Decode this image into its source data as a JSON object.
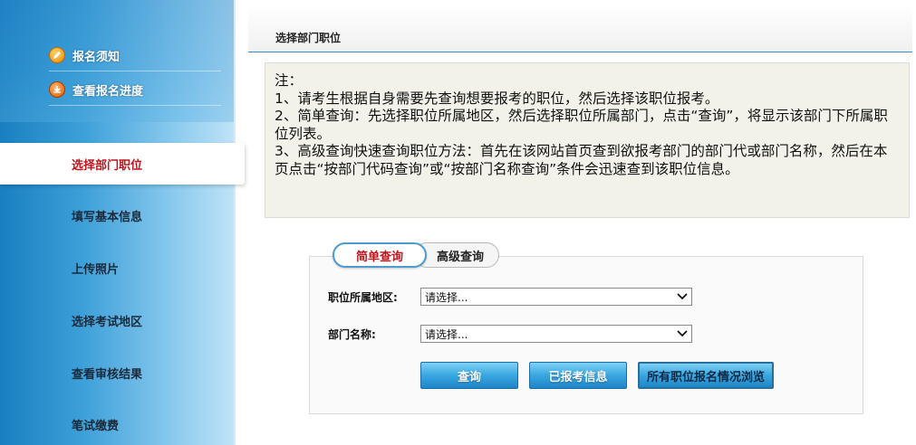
{
  "sidebar": {
    "top_links": [
      {
        "label": "报名须知",
        "icon": "pencil-icon"
      },
      {
        "label": "查看报名进度",
        "icon": "progress-icon"
      }
    ],
    "items": [
      {
        "label": "选择部门职位",
        "active": true
      },
      {
        "label": "填写基本信息"
      },
      {
        "label": "上传照片"
      },
      {
        "label": "选择考试地区"
      },
      {
        "label": "查看审核结果"
      },
      {
        "label": "笔试缴费"
      }
    ]
  },
  "main": {
    "title": "选择部门职位",
    "note": {
      "heading": "注：",
      "lines": [
        "1、请考生根据自身需要先查询想要报考的职位，然后选择该职位报考。",
        "2、简单查询：先选择职位所属地区，然后选择职位所属部门，点击“查询”，将显示该部门下所属职位列表。",
        "3、高级查询快速查询职位方法：首先在该网站首页查到欲报考部门的部门代或部门名称，然后在本页点击“按部门代码查询”或“按部门名称查询”条件会迅速查到该职位信息。"
      ]
    },
    "tabs": [
      {
        "label": "简单查询",
        "active": true
      },
      {
        "label": "高级查询"
      }
    ],
    "form": {
      "region_label": "职位所属地区:",
      "region_value": "请选择...",
      "dept_label": "部门名称:",
      "dept_value": "请选择..."
    },
    "buttons": {
      "query": "查询",
      "registered": "已报考信息",
      "browse_all": "所有职位报名情况浏览"
    }
  },
  "colors": {
    "accent_blue": "#3a8ec8",
    "active_red": "#c0141b"
  }
}
